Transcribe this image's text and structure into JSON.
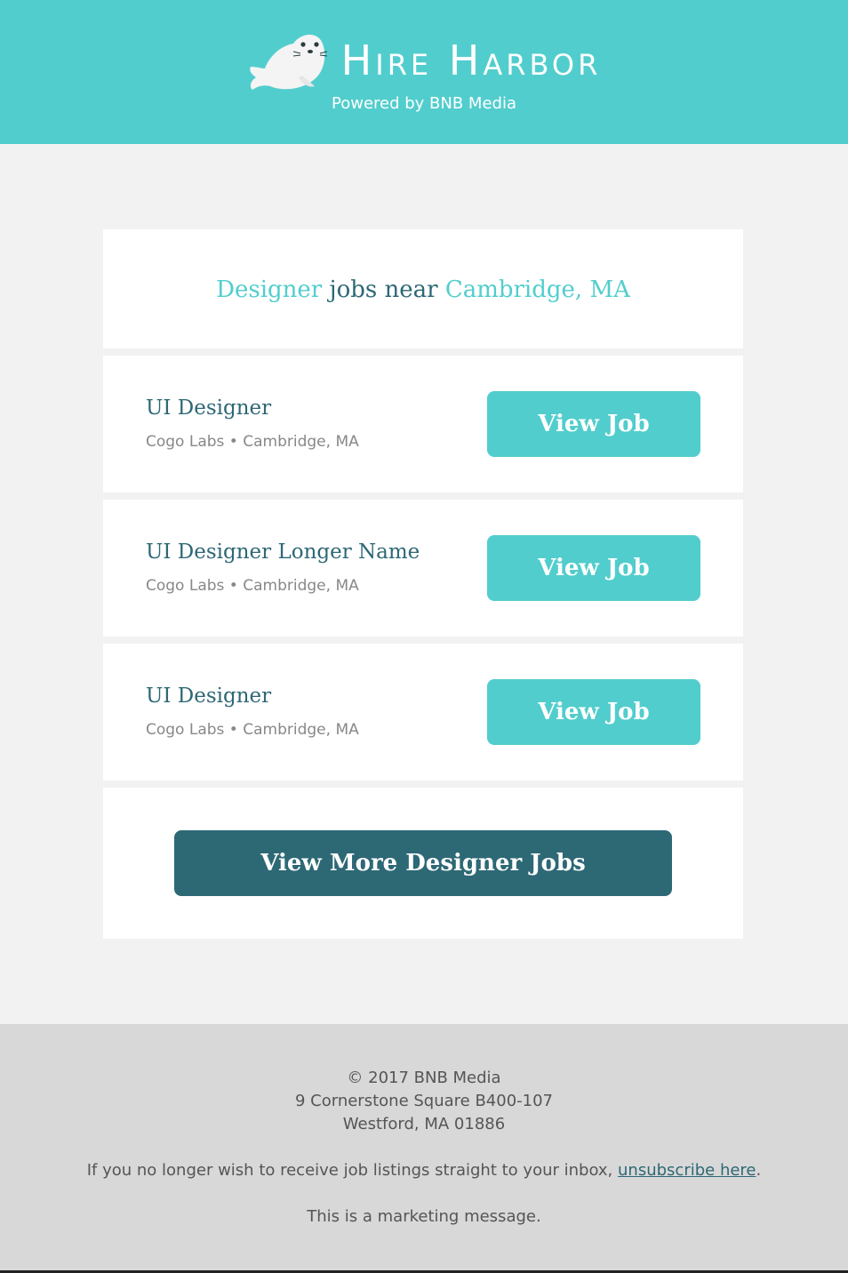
{
  "header": {
    "brand": "Hire Harbor",
    "powered_by": "Powered by BNB Media",
    "logo_icon": "seal-icon",
    "bg_color": "#52cdcd"
  },
  "search": {
    "role": "Designer",
    "connector": "jobs near",
    "location": "Cambridge, MA"
  },
  "jobs": [
    {
      "title": "UI Designer",
      "company": "Cogo Labs",
      "location": "Cambridge, MA",
      "button": "View Job"
    },
    {
      "title": "UI Designer Longer Name",
      "company": "Cogo Labs",
      "location": "Cambridge, MA",
      "button": "View Job"
    },
    {
      "title": "UI Designer",
      "company": "Cogo Labs",
      "location": "Cambridge, MA",
      "button": "View Job"
    }
  ],
  "more_button": "View More Designer Jobs",
  "footer": {
    "copyright": "© 2017 BNB Media",
    "address_line1": "9 Cornerstone Square B400-107",
    "address_line2": "Westford, MA 01886",
    "unsubscribe_prefix": "If you no longer wish to receive job listings straight to your inbox,",
    "unsubscribe_link": "unsubscribe here",
    "unsubscribe_suffix": ".",
    "marketing": "This is a marketing message."
  },
  "colors": {
    "accent": "#52cdcd",
    "dark": "#2d6875"
  }
}
